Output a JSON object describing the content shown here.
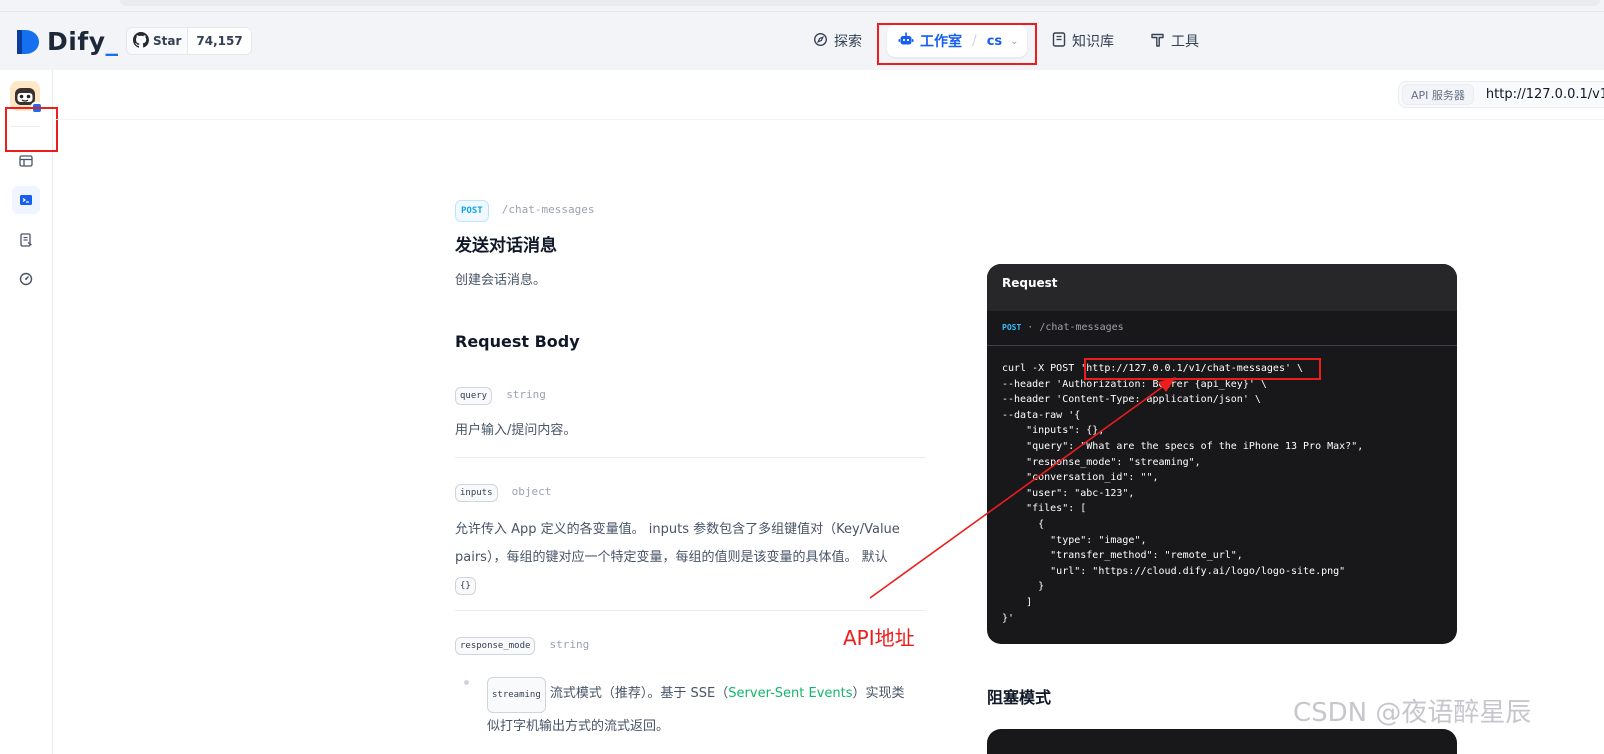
{
  "header": {
    "logo_text": "Dify",
    "github_label": "Star",
    "github_count": "74,157",
    "nav": {
      "explore": "探索",
      "studio": "工作室",
      "workspace": "cs",
      "knowledge": "知识库",
      "tools": "工具"
    }
  },
  "api_server": {
    "tag": "API 服务器",
    "url": "http://127.0.0.1/v1"
  },
  "doc": {
    "method": "POST",
    "endpoint": "/chat-messages",
    "title": "发送对话消息",
    "description": "创建会话消息。",
    "body_heading": "Request Body",
    "params": [
      {
        "name": "query",
        "type": "string",
        "desc": "用户输入/提问内容。"
      },
      {
        "name": "inputs",
        "type": "object",
        "desc_line1": "允许传入 App 定义的各变量值。 inputs 参数包含了多组键值对（Key/Value",
        "desc_line2": "pairs），每组的键对应一个特定变量，每组的值则是该变量的具体值。 默认",
        "default": "{}"
      },
      {
        "name": "response_mode",
        "type": "string"
      }
    ],
    "streaming": {
      "tag": "streaming",
      "text_a": "流式模式（推荐）。基于 SSE（",
      "link": "Server-Sent Events",
      "text_b": "）实现类",
      "text_c": "似打字机输出方式的流式返回。"
    }
  },
  "code": {
    "title": "Request",
    "method": "POST",
    "sep": "·",
    "endpoint": "/chat-messages",
    "body": "curl -X POST 'http://127.0.0.1/v1/chat-messages' \\\n--header 'Authorization: Bearer {api_key}' \\\n--header 'Content-Type: application/json' \\\n--data-raw '{\n    \"inputs\": {},\n    \"query\": \"What are the specs of the iPhone 13 Pro Max?\",\n    \"response_mode\": \"streaming\",\n    \"conversation_id\": \"\",\n    \"user\": \"abc-123\",\n    \"files\": [\n      {\n        \"type\": \"image\",\n        \"transfer_method\": \"remote_url\",\n        \"url\": \"https://cloud.dify.ai/logo/logo-site.png\"\n      }\n    ]\n}'"
  },
  "block_title": "阻塞模式",
  "annotation": "API地址",
  "watermark": "CSDN @夜语醉星辰",
  "colors": {
    "annotation_red": "#ee1d1d",
    "accent_blue": "#155eef",
    "code_bg": "#18181b"
  }
}
